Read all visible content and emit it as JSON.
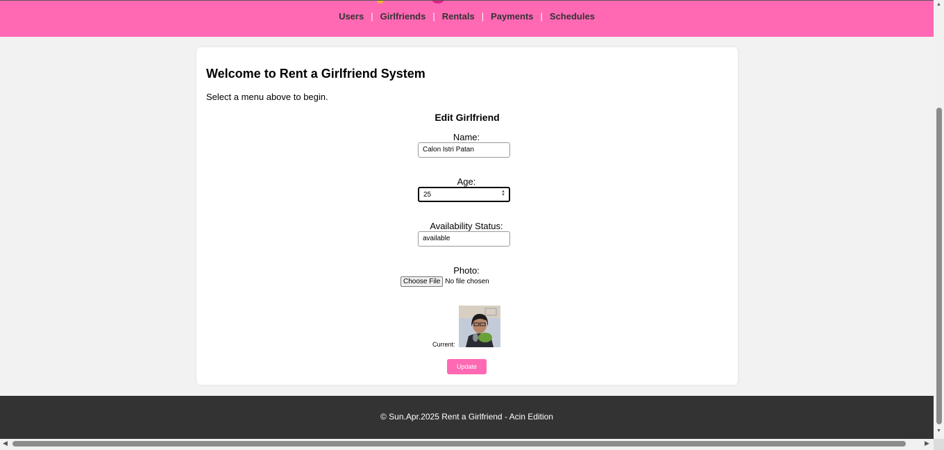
{
  "nav": {
    "items": [
      "Users",
      "Girlfriends",
      "Rentals",
      "Payments",
      "Schedules"
    ],
    "separator": "|"
  },
  "main": {
    "title": "Welcome to Rent a Girlfriend System",
    "intro": "Select a menu above to begin."
  },
  "form": {
    "title": "Edit Girlfriend",
    "name_label": "Name:",
    "name_value": "Calon Istri Patan",
    "age_label": "Age:",
    "age_value": "25",
    "status_label": "Availability Status:",
    "status_value": "available",
    "photo_label": "Photo:",
    "file_button": "Choose File",
    "file_status": "No file chosen",
    "current_label": "Current:",
    "update_button": "Update"
  },
  "footer": {
    "text": "© Sun.Apr.2025 Rent a Girlfriend - Acin Edition"
  },
  "colors": {
    "header_bg": "#ff69b4",
    "button_bg": "#ff69b4",
    "footer_bg": "#333333",
    "page_bg": "#f2f2f2"
  }
}
